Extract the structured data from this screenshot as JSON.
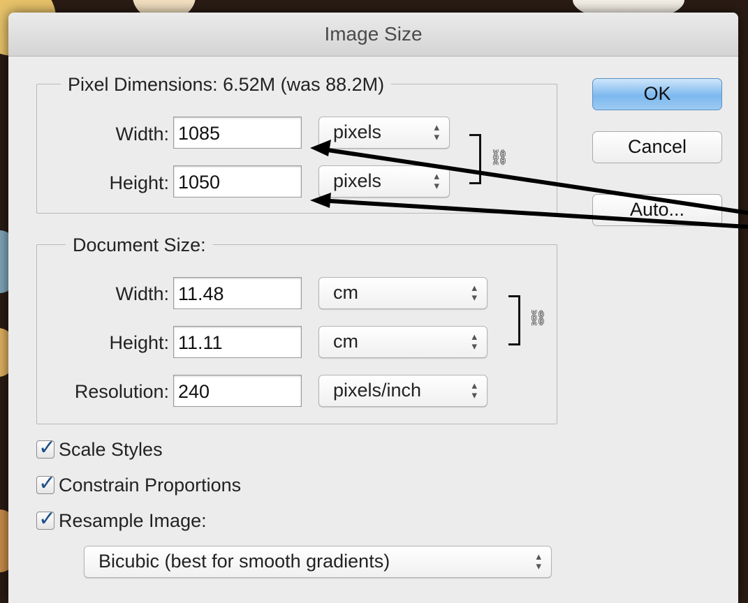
{
  "dialog": {
    "title": "Image Size"
  },
  "pixel_dimensions": {
    "legend": "Pixel Dimensions:  6.52M (was 88.2M)",
    "width_label": "Width:",
    "width_value": "1085",
    "width_unit": "pixels",
    "height_label": "Height:",
    "height_value": "1050",
    "height_unit": "pixels"
  },
  "document_size": {
    "legend": "Document Size:",
    "width_label": "Width:",
    "width_value": "11.48",
    "width_unit": "cm",
    "height_label": "Height:",
    "height_value": "11.11",
    "height_unit": "cm",
    "resolution_label": "Resolution:",
    "resolution_value": "240",
    "resolution_unit": "pixels/inch"
  },
  "buttons": {
    "ok": "OK",
    "cancel": "Cancel",
    "auto": "Auto..."
  },
  "options": {
    "scale_styles": "Scale Styles",
    "constrain_proportions": "Constrain Proportions",
    "resample_image": "Resample Image:",
    "resample_method": "Bicubic (best for smooth gradients)"
  },
  "icons": {
    "link": "chain-link-icon",
    "stepper": "up-down-arrows-icon",
    "checkmark": "checkmark-icon",
    "annotation": "black-arrow"
  },
  "colors": {
    "dialog_bg": "#ececec",
    "ok_button": "#7cb8ee",
    "checkmark": "#1d4f8a",
    "annotation_arrow": "#000000"
  }
}
